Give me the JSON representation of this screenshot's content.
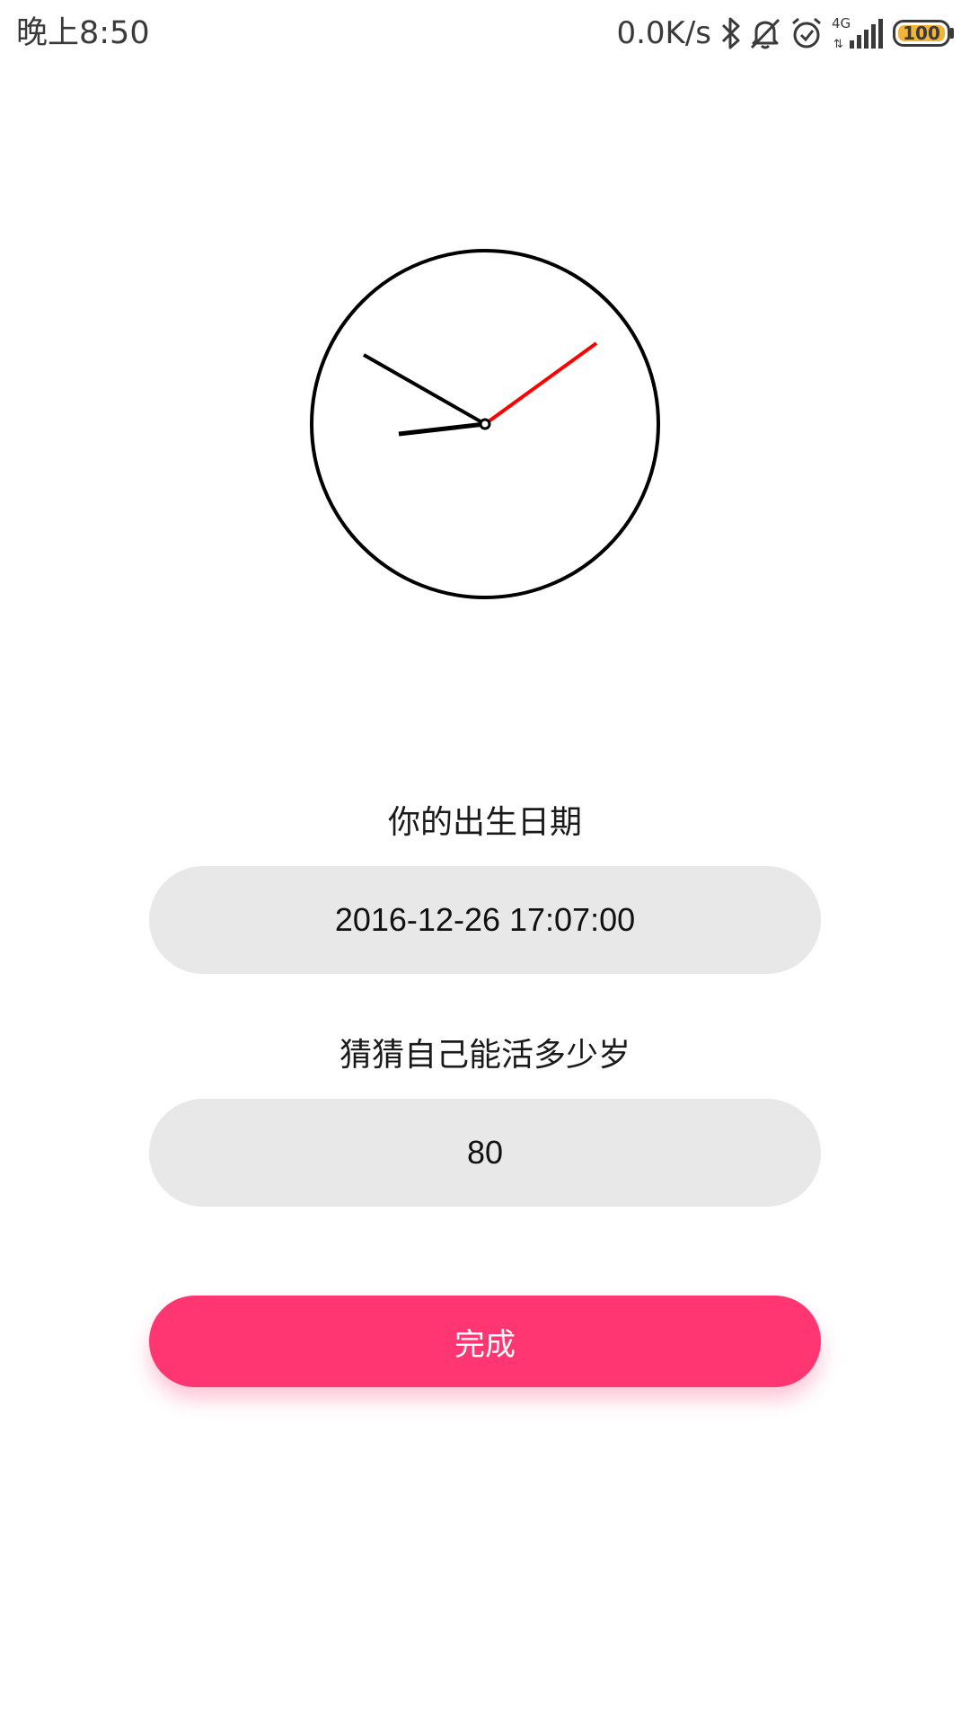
{
  "status_bar": {
    "time": "晚上8:50",
    "net_speed": "0.0K/s",
    "network_type": "4G",
    "battery": "100",
    "battery_level": 1.0,
    "battery_color": "#f1b43a",
    "icons": [
      "bluetooth-icon",
      "notifications-off-icon",
      "alarm-icon",
      "signal-icon",
      "battery-icon"
    ]
  },
  "clock": {
    "time_shown": "8:50:xx",
    "hour_hand_color": "#000000",
    "minute_hand_color": "#000000",
    "second_hand_color": "#ff0000"
  },
  "form": {
    "birth_label": "你的出生日期",
    "birth_value": "2016-12-26 17:07:00",
    "age_label": "猜猜自己能活多少岁",
    "age_value": "80",
    "done_label": "完成"
  },
  "colors": {
    "accent": "#ff3672",
    "field_background": "#e8e8e8"
  }
}
